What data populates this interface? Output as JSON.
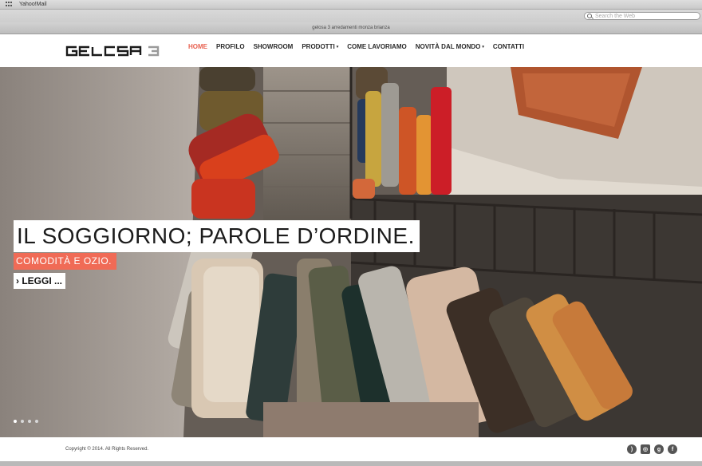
{
  "browser": {
    "bookmark_label": "Yahoo!Mail",
    "search_placeholder": "Search the Web",
    "window_title": "gelosa 3 arredamenti monza brianza"
  },
  "header": {
    "logo_text": "GELOSA 3",
    "nav": [
      {
        "label": "HOME",
        "active": true
      },
      {
        "label": "PROFILO"
      },
      {
        "label": "SHOWROOM"
      },
      {
        "label": "PRODOTTI",
        "caret": "▾"
      },
      {
        "label": "COME LAVORIAMO"
      },
      {
        "label": "NOVITÀ DAL MONDO",
        "caret": "▾"
      },
      {
        "label": "CONTATTI"
      }
    ]
  },
  "hero": {
    "headline": "IL SOGGIORNO; PAROLE D’ORDINE.",
    "subhead": "COMODITÀ E OZIO.",
    "button": "LEGGI ...",
    "button_icon": "›",
    "slides": 4,
    "active_slide": 1
  },
  "footer": {
    "copyright": "Copyright © 2014. All Rights Reserved.",
    "social": [
      {
        "name": "rss-icon",
        "glyph": ")"
      },
      {
        "name": "instagram-icon",
        "glyph": "◎"
      },
      {
        "name": "googleplus-icon",
        "glyph": "g"
      },
      {
        "name": "facebook-icon",
        "glyph": "f"
      }
    ]
  },
  "colors": {
    "accent": "#e8604f",
    "subhead_bg": "#f06b56"
  }
}
